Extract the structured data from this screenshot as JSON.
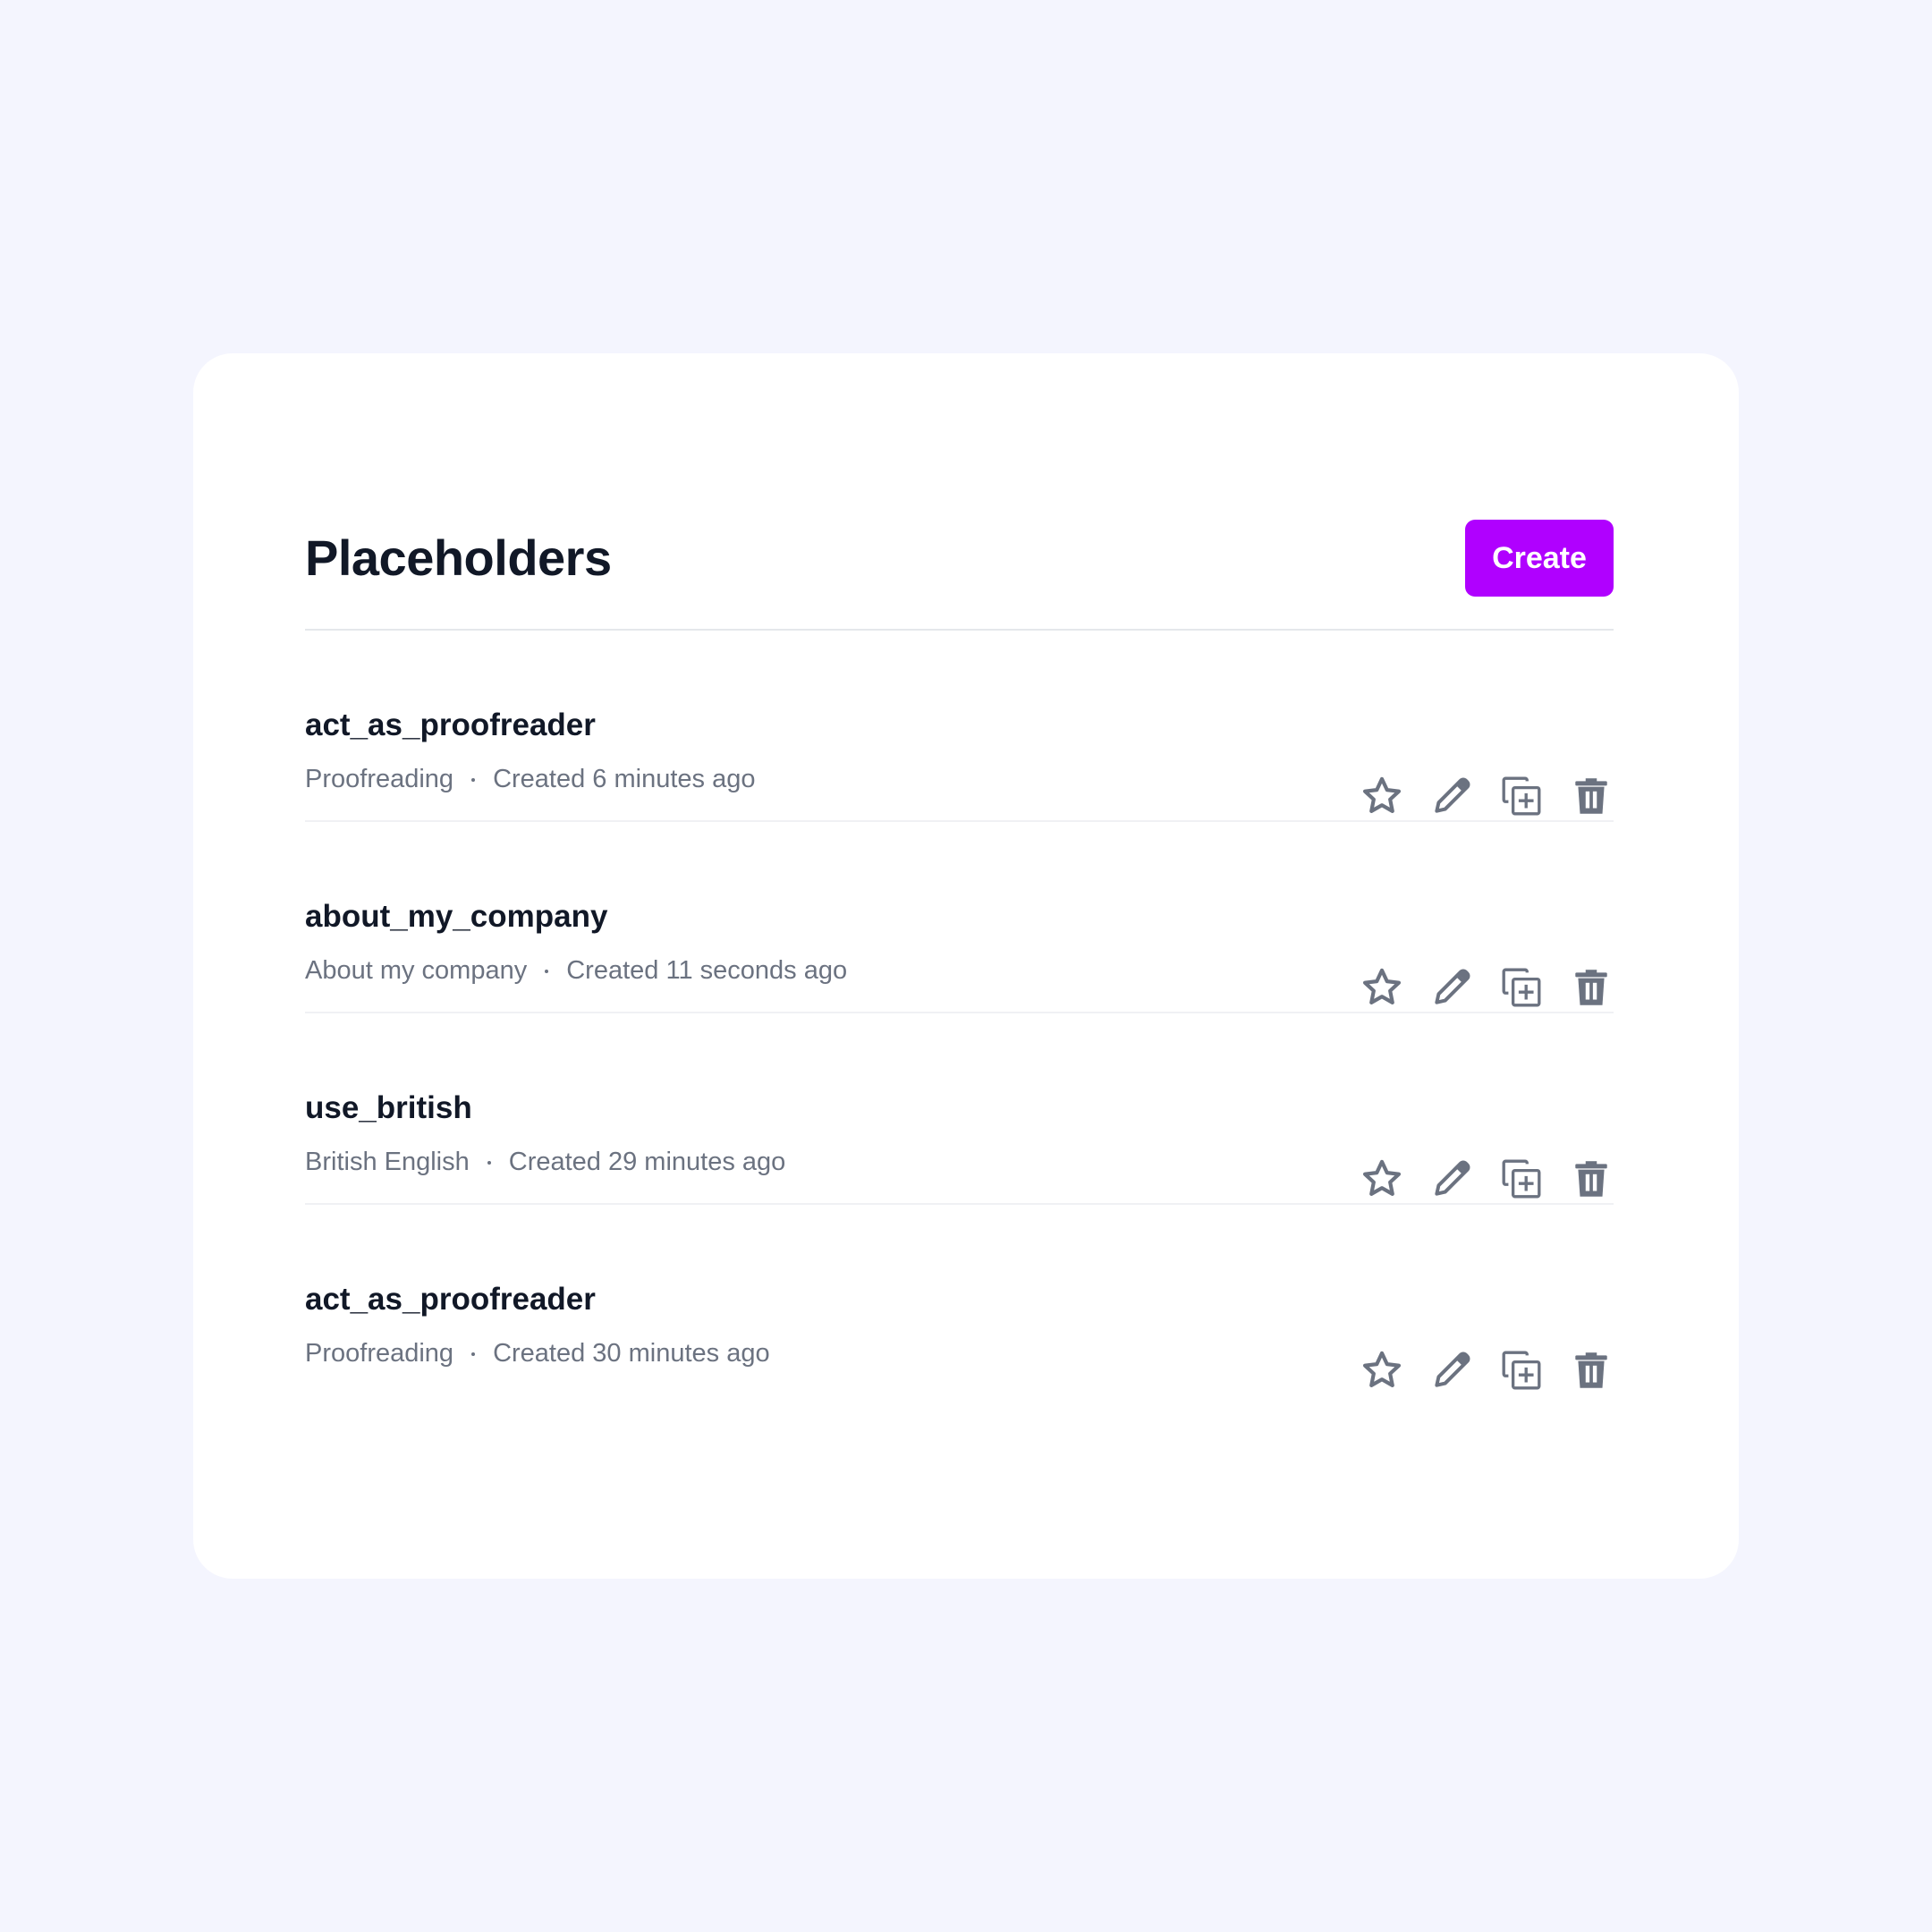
{
  "page": {
    "title": "Placeholders",
    "create_label": "Create"
  },
  "colors": {
    "background": "#f4f5fe",
    "card": "#ffffff",
    "accent": "#b000ff",
    "icon": "#6b7280",
    "title_text": "#111827",
    "meta_text": "#6b7280"
  },
  "placeholders": [
    {
      "name": "act_as_proofreader",
      "category": "Proofreading",
      "created": "Created 6 minutes ago",
      "actions": [
        "star-icon",
        "pencil-icon",
        "duplicate-icon",
        "trash-icon"
      ]
    },
    {
      "name": "about_my_company",
      "category": "About my company",
      "created": "Created 11 seconds ago",
      "actions": [
        "star-icon",
        "pencil-icon",
        "duplicate-icon",
        "trash-icon"
      ]
    },
    {
      "name": "use_british",
      "category": "British English",
      "created": "Created 29 minutes ago",
      "actions": [
        "star-icon",
        "pencil-icon",
        "duplicate-icon",
        "trash-icon"
      ]
    },
    {
      "name": "act_as_proofreader",
      "category": "Proofreading",
      "created": "Created 30 minutes ago",
      "actions": [
        "star-icon",
        "pencil-icon",
        "duplicate-icon",
        "trash-icon"
      ]
    }
  ]
}
